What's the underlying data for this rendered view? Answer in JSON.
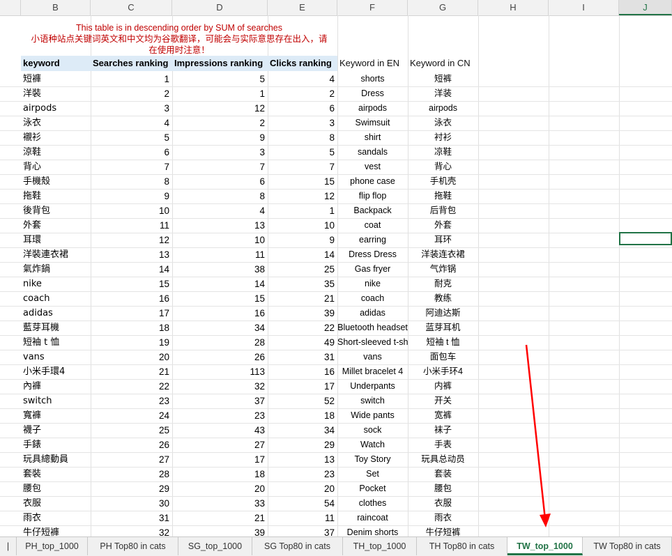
{
  "columns": [
    "B",
    "C",
    "D",
    "E",
    "F",
    "G",
    "H",
    "I",
    "J"
  ],
  "note_line1": "This table is in descending order by SUM of searches",
  "note_line2": "小语种站点关键词英文和中文均为谷歌翻译，可能会与实际意思存在出入，请",
  "note_line3": "在使用时注意！",
  "headers": {
    "keyword": "keyword",
    "searches": "Searches ranking",
    "impressions": "Impressions ranking",
    "clicks": "Clicks ranking",
    "en": "Keyword in EN",
    "cn": "Keyword in CN"
  },
  "rows": [
    {
      "kw": "短褲",
      "s": "1",
      "i": "5",
      "c": "4",
      "en": "shorts",
      "cn": "短裤"
    },
    {
      "kw": "洋裝",
      "s": "2",
      "i": "1",
      "c": "2",
      "en": "Dress",
      "cn": "洋装"
    },
    {
      "kw": "airpods",
      "s": "3",
      "i": "12",
      "c": "6",
      "en": "airpods",
      "cn": "airpods"
    },
    {
      "kw": "泳衣",
      "s": "4",
      "i": "2",
      "c": "3",
      "en": "Swimsuit",
      "cn": "泳衣"
    },
    {
      "kw": "襯衫",
      "s": "5",
      "i": "9",
      "c": "8",
      "en": "shirt",
      "cn": "衬衫"
    },
    {
      "kw": "涼鞋",
      "s": "6",
      "i": "3",
      "c": "5",
      "en": "sandals",
      "cn": "凉鞋"
    },
    {
      "kw": "背心",
      "s": "7",
      "i": "7",
      "c": "7",
      "en": "vest",
      "cn": "背心"
    },
    {
      "kw": "手機殼",
      "s": "8",
      "i": "6",
      "c": "15",
      "en": "phone case",
      "cn": "手机壳"
    },
    {
      "kw": "拖鞋",
      "s": "9",
      "i": "8",
      "c": "12",
      "en": "flip flop",
      "cn": "拖鞋"
    },
    {
      "kw": "後背包",
      "s": "10",
      "i": "4",
      "c": "1",
      "en": "Backpack",
      "cn": "后背包"
    },
    {
      "kw": "外套",
      "s": "11",
      "i": "13",
      "c": "10",
      "en": "coat",
      "cn": "外套"
    },
    {
      "kw": "耳環",
      "s": "12",
      "i": "10",
      "c": "9",
      "en": "earring",
      "cn": "耳环"
    },
    {
      "kw": "洋裝連衣裙",
      "s": "13",
      "i": "11",
      "c": "14",
      "en": "Dress Dress",
      "cn": "洋装连衣裙"
    },
    {
      "kw": "氣炸鍋",
      "s": "14",
      "i": "38",
      "c": "25",
      "en": "Gas fryer",
      "cn": "气炸锅"
    },
    {
      "kw": "nike",
      "s": "15",
      "i": "14",
      "c": "35",
      "en": "nike",
      "cn": "耐克"
    },
    {
      "kw": "coach",
      "s": "16",
      "i": "15",
      "c": "21",
      "en": "coach",
      "cn": "教练"
    },
    {
      "kw": "adidas",
      "s": "17",
      "i": "16",
      "c": "39",
      "en": "adidas",
      "cn": "阿迪达斯"
    },
    {
      "kw": "藍芽耳機",
      "s": "18",
      "i": "34",
      "c": "22",
      "en": "Bluetooth headset",
      "cn": "蓝芽耳机"
    },
    {
      "kw": "短袖 t 恤",
      "s": "19",
      "i": "28",
      "c": "49",
      "en": "Short-sleeved t-shirt",
      "cn": "短袖 t 恤"
    },
    {
      "kw": "vans",
      "s": "20",
      "i": "26",
      "c": "31",
      "en": "vans",
      "cn": "面包车"
    },
    {
      "kw": "小米手環4",
      "s": "21",
      "i": "113",
      "c": "16",
      "en": "Millet bracelet 4",
      "cn": "小米手环4"
    },
    {
      "kw": "內褲",
      "s": "22",
      "i": "32",
      "c": "17",
      "en": "Underpants",
      "cn": "内裤"
    },
    {
      "kw": "switch",
      "s": "23",
      "i": "37",
      "c": "52",
      "en": "switch",
      "cn": "开关"
    },
    {
      "kw": "寬褲",
      "s": "24",
      "i": "23",
      "c": "18",
      "en": "Wide pants",
      "cn": "宽裤"
    },
    {
      "kw": "襪子",
      "s": "25",
      "i": "43",
      "c": "34",
      "en": "sock",
      "cn": "袜子"
    },
    {
      "kw": "手錶",
      "s": "26",
      "i": "27",
      "c": "29",
      "en": "Watch",
      "cn": "手表"
    },
    {
      "kw": "玩具總動員",
      "s": "27",
      "i": "17",
      "c": "13",
      "en": "Toy Story",
      "cn": "玩具总动员"
    },
    {
      "kw": "套裝",
      "s": "28",
      "i": "18",
      "c": "23",
      "en": "Set",
      "cn": "套装"
    },
    {
      "kw": "腰包",
      "s": "29",
      "i": "20",
      "c": "20",
      "en": "Pocket",
      "cn": "腰包"
    },
    {
      "kw": "衣服",
      "s": "30",
      "i": "33",
      "c": "54",
      "en": "clothes",
      "cn": "衣服"
    },
    {
      "kw": "雨衣",
      "s": "31",
      "i": "21",
      "c": "11",
      "en": "raincoat",
      "cn": "雨衣"
    },
    {
      "kw": "牛仔短褲",
      "s": "32",
      "i": "39",
      "c": "37",
      "en": "Denim shorts",
      "cn": "牛仔短裤"
    }
  ],
  "sheet_tabs": [
    "PH_top_1000",
    "PH Top80 in cats",
    "SG_top_1000",
    "SG Top80 in cats",
    "TH_top_1000",
    "TH Top80 in cats",
    "TW_top_1000",
    "TW Top80 in cats"
  ],
  "active_tab": "TW_top_1000",
  "colors": {
    "accent": "#217346",
    "note": "#c00000",
    "header_band": "#ddebf7",
    "arrow": "#ff0000"
  }
}
